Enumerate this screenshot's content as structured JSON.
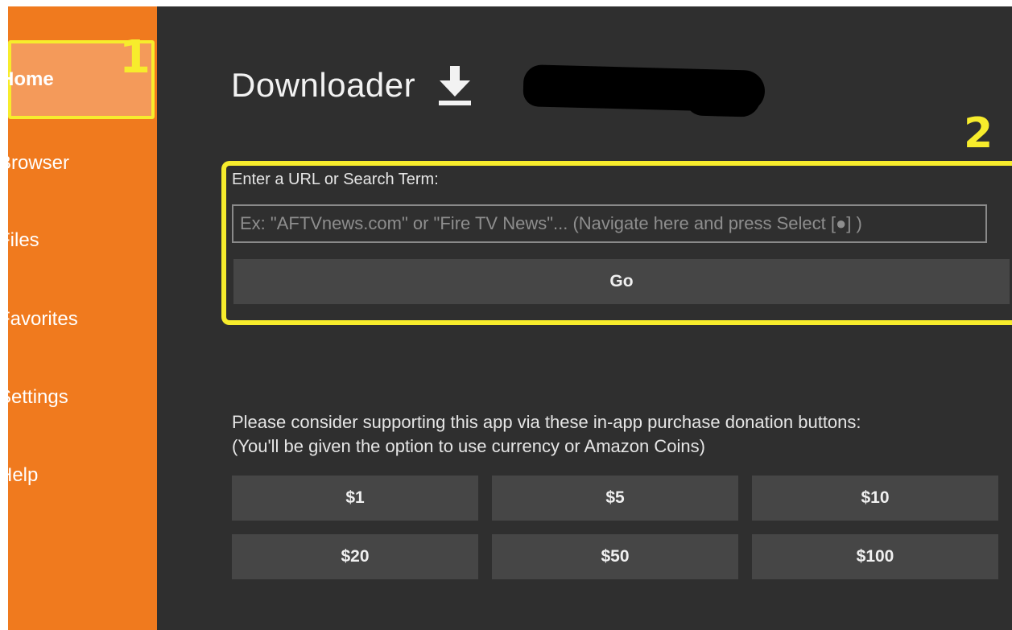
{
  "sidebar": {
    "items": [
      {
        "label": "Home",
        "active": true
      },
      {
        "label": "Browser"
      },
      {
        "label": "Files"
      },
      {
        "label": "Favorites"
      },
      {
        "label": "Settings"
      },
      {
        "label": "Help"
      }
    ]
  },
  "annotations": {
    "marker_1": "1",
    "marker_2": "2",
    "color": "#f7ec2c"
  },
  "header": {
    "title": "Downloader",
    "icon": "download-icon"
  },
  "url_panel": {
    "label": "Enter a URL or Search Term:",
    "placeholder": "Ex: \"AFTVnews.com\" or \"Fire TV News\"... (Navigate here and press Select [●] )",
    "value": "",
    "go_label": "Go"
  },
  "donation": {
    "line1": "Please consider supporting this app via these in-app purchase donation buttons:",
    "line2": "(You'll be given the option to use currency or Amazon Coins)",
    "buttons": [
      "$1",
      "$5",
      "$10",
      "$20",
      "$50",
      "$100"
    ]
  },
  "colors": {
    "sidebar": "#f07a1e",
    "sidebar_active": "#f49a5a",
    "background": "#2f2f2f",
    "button": "#464646",
    "highlight": "#f7ec2c"
  }
}
